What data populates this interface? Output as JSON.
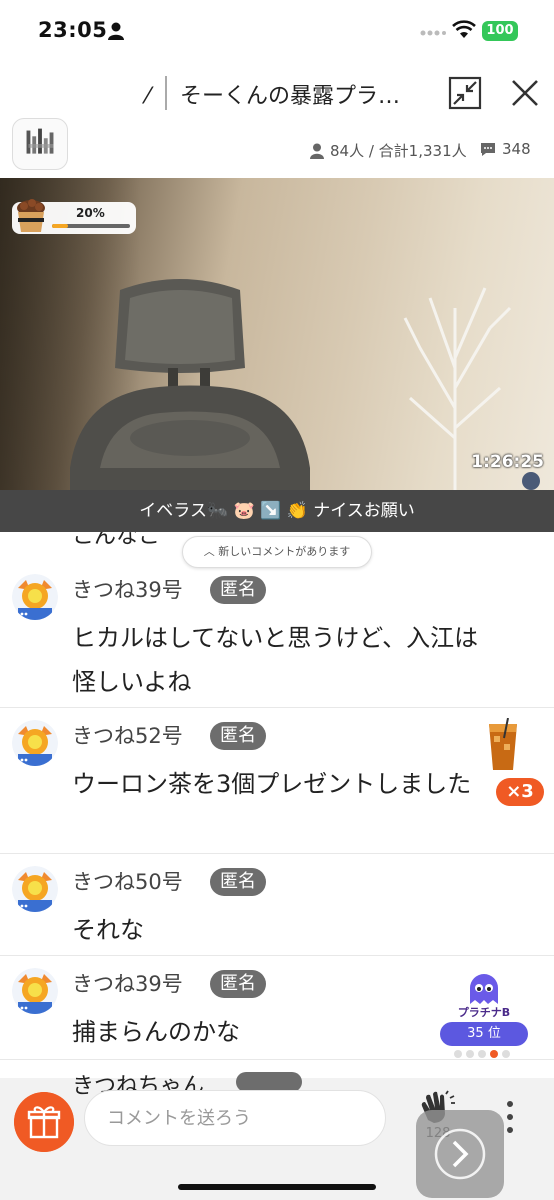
{
  "status_bar": {
    "time": "23:05",
    "battery": "100"
  },
  "title_bar": {
    "slash": "⁄",
    "title": "そーくんの暴露プラ…"
  },
  "info": {
    "viewers": "84人 / 合計1,331人",
    "comments": "348"
  },
  "video": {
    "gift_progress": "20%",
    "gift_progress_value": 0.2,
    "elapsed": "1:26:25"
  },
  "ticker": {
    "text": "イベラス🐜 🐷 ↘️ 👏 ナイスお願い"
  },
  "comment_list": {
    "partial_top": "こんなこ",
    "new_comment_notice": "︿ 新しいコメントがあります",
    "comments": [
      {
        "name": "きつね39号",
        "badge": "匿名",
        "body": "ヒカルはしてないと思うけど、入江は怪しいよね"
      },
      {
        "name": "きつね52号",
        "badge": "匿名",
        "body": "ウーロン茶を3個プレゼントしました",
        "gift_count": "×3"
      },
      {
        "name": "きつね50号",
        "badge": "匿名",
        "body": "それな"
      },
      {
        "name": "きつね39号",
        "badge": "匿名",
        "body": "捕まらんのかな"
      }
    ],
    "partial_bottom": "きつねちゃん"
  },
  "rank": {
    "tier": "プラチナB",
    "position": "35 位"
  },
  "bottom_bar": {
    "input_placeholder": "コメントを送ろう",
    "clap_count": "128"
  },
  "colors": {
    "accent": "#f05a24",
    "badge": "#6d6d6d",
    "rank": "#5c58e0",
    "battery": "#34c759"
  }
}
